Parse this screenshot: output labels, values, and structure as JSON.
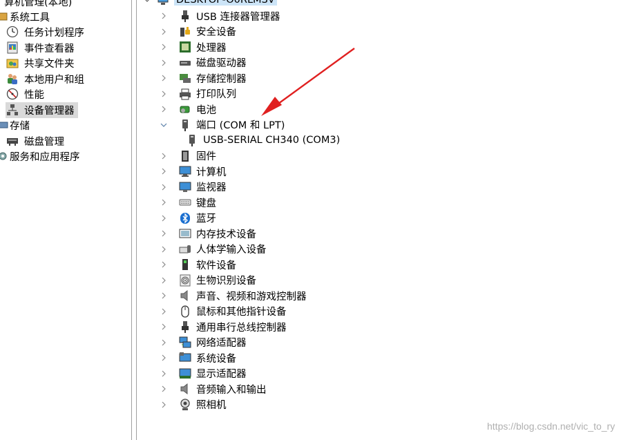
{
  "left_tree": {
    "root_label": "算机管理(本地)",
    "items": [
      {
        "label": "系统工具",
        "icon": "tools-icon"
      },
      {
        "label": "任务计划程序",
        "icon": "clock-icon"
      },
      {
        "label": "事件查看器",
        "icon": "event-viewer-icon"
      },
      {
        "label": "共享文件夹",
        "icon": "shared-folder-icon"
      },
      {
        "label": "本地用户和组",
        "icon": "users-icon"
      },
      {
        "label": "性能",
        "icon": "performance-icon"
      },
      {
        "label": "设备管理器",
        "icon": "device-manager-icon"
      },
      {
        "label": "存储",
        "icon": "storage-icon"
      },
      {
        "label": "磁盘管理",
        "icon": "disk-management-icon"
      },
      {
        "label": "服务和应用程序",
        "icon": "services-icon"
      }
    ]
  },
  "device_tree": {
    "root_label": "DESKTOP-O0RLMSV",
    "categories": [
      {
        "label": "USB 连接器管理器",
        "icon": "usb-connector-icon"
      },
      {
        "label": "安全设备",
        "icon": "security-device-icon"
      },
      {
        "label": "处理器",
        "icon": "processor-icon"
      },
      {
        "label": "磁盘驱动器",
        "icon": "disk-drive-icon"
      },
      {
        "label": "存储控制器",
        "icon": "storage-controller-icon"
      },
      {
        "label": "打印队列",
        "icon": "printer-icon"
      },
      {
        "label": "电池",
        "icon": "battery-icon"
      },
      {
        "label": "端口 (COM 和 LPT)",
        "icon": "port-icon",
        "expanded": true
      },
      {
        "label": "USB-SERIAL CH340 (COM3)",
        "icon": "port-icon",
        "child": true
      },
      {
        "label": "固件",
        "icon": "firmware-icon"
      },
      {
        "label": "计算机",
        "icon": "computer-icon"
      },
      {
        "label": "监视器",
        "icon": "monitor-icon"
      },
      {
        "label": "键盘",
        "icon": "keyboard-icon"
      },
      {
        "label": "蓝牙",
        "icon": "bluetooth-icon"
      },
      {
        "label": "内存技术设备",
        "icon": "memory-device-icon"
      },
      {
        "label": "人体学输入设备",
        "icon": "hid-icon"
      },
      {
        "label": "软件设备",
        "icon": "software-device-icon"
      },
      {
        "label": "生物识别设备",
        "icon": "fingerprint-icon"
      },
      {
        "label": "声音、视频和游戏控制器",
        "icon": "speaker-icon"
      },
      {
        "label": "鼠标和其他指针设备",
        "icon": "mouse-icon"
      },
      {
        "label": "通用串行总线控制器",
        "icon": "usb-controller-icon"
      },
      {
        "label": "网络适配器",
        "icon": "network-adapter-icon"
      },
      {
        "label": "系统设备",
        "icon": "system-device-icon"
      },
      {
        "label": "显示适配器",
        "icon": "display-adapter-icon"
      },
      {
        "label": "音频输入和输出",
        "icon": "audio-io-icon"
      },
      {
        "label": "照相机",
        "icon": "camera-icon"
      }
    ]
  },
  "watermark": "https://blog.csdn.net/vic_to_ry",
  "colors": {
    "selection": "#d9d9d9",
    "root_highlight": "#cce4f7",
    "annotation_arrow": "#e02020"
  }
}
